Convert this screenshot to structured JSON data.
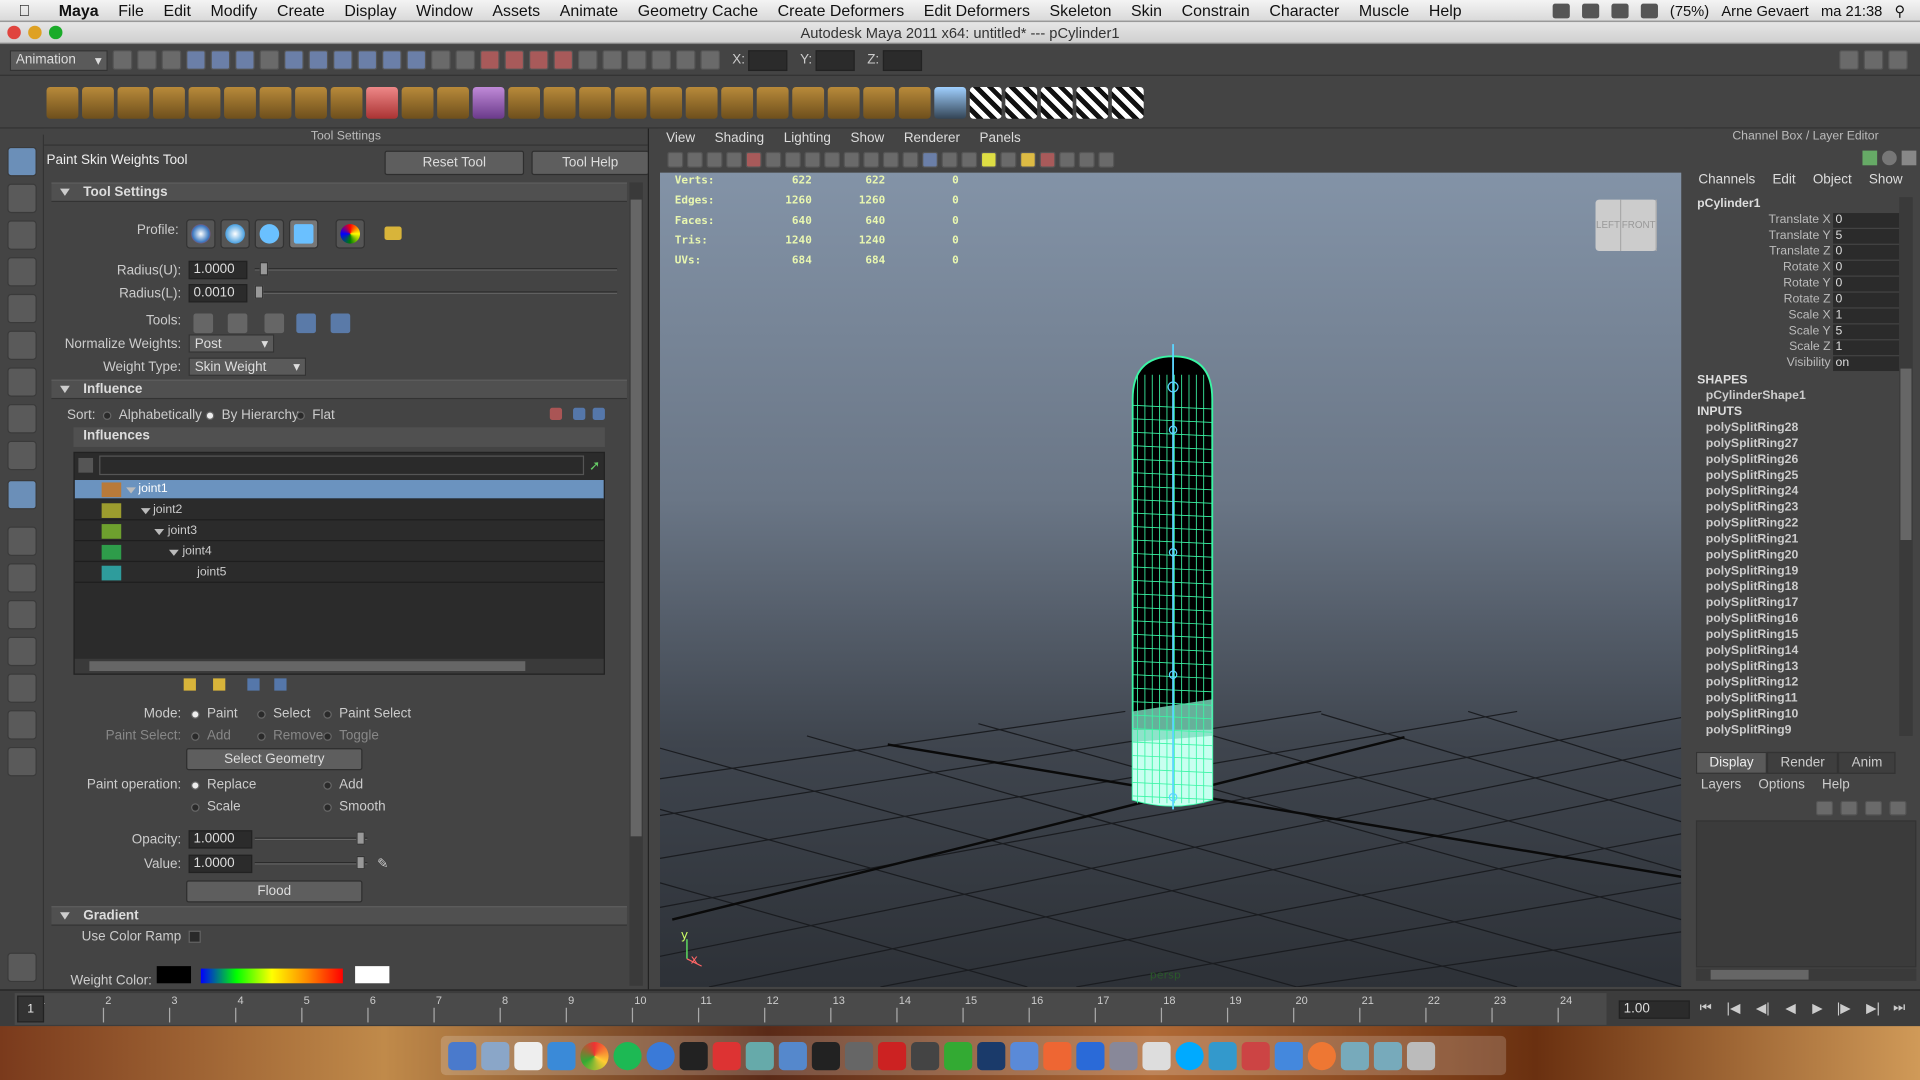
{
  "macmenu": {
    "app": "Maya",
    "items": [
      "File",
      "Edit",
      "Modify",
      "Create",
      "Display",
      "Window",
      "Assets",
      "Animate",
      "Geometry Cache",
      "Create Deformers",
      "Edit Deformers",
      "Skeleton",
      "Skin",
      "Constrain",
      "Character",
      "Muscle",
      "Help"
    ],
    "battery": "(75%)",
    "user": "Arne Gevaert",
    "clock": "ma 21:38"
  },
  "window": {
    "title": "Autodesk Maya 2011 x64: untitled*   ---   pCylinder1"
  },
  "statusline": {
    "menuset": "Animation",
    "x_label": "X:",
    "y_label": "Y:",
    "z_label": "Z:"
  },
  "toolsettings": {
    "header": "Tool Settings",
    "tool_name": "Paint Skin Weights Tool",
    "reset": "Reset Tool",
    "help": "Tool Help",
    "section_tool": "Tool Settings",
    "profile_label": "Profile:",
    "radius_u_label": "Radius(U):",
    "radius_u": "1.0000",
    "radius_l_label": "Radius(L):",
    "radius_l": "0.0010",
    "tools_label": "Tools:",
    "normalize_label": "Normalize Weights:",
    "normalize_value": "Post",
    "weight_type_label": "Weight Type:",
    "weight_type_value": "Skin Weight",
    "section_influence": "Influence",
    "sort_label": "Sort:",
    "sort_alpha": "Alphabetically",
    "sort_hier": "By Hierarchy",
    "sort_flat": "Flat",
    "influences_header": "Influences",
    "joints": [
      "joint1",
      "joint2",
      "joint3",
      "joint4",
      "joint5"
    ],
    "joint_colors": [
      "#b87a3a",
      "#9c9c2e",
      "#6ea02e",
      "#2e9c4a",
      "#2e9c9c"
    ],
    "mode_label": "Mode:",
    "mode_paint": "Paint",
    "mode_select": "Select",
    "mode_paint_select": "Paint Select",
    "paint_select_label": "Paint Select:",
    "ps_add": "Add",
    "ps_remove": "Remove",
    "ps_toggle": "Toggle",
    "select_geometry": "Select Geometry",
    "paint_op_label": "Paint operation:",
    "op_replace": "Replace",
    "op_add": "Add",
    "op_scale": "Scale",
    "op_smooth": "Smooth",
    "opacity_label": "Opacity:",
    "opacity": "1.0000",
    "value_label": "Value:",
    "value": "1.0000",
    "flood": "Flood",
    "section_gradient": "Gradient",
    "use_color_ramp": "Use Color Ramp",
    "weight_color_label": "Weight Color:"
  },
  "viewport": {
    "menu": [
      "View",
      "Shading",
      "Lighting",
      "Show",
      "Renderer",
      "Panels"
    ],
    "hud": [
      {
        "label": "Verts:",
        "a": "622",
        "b": "622",
        "c": "0"
      },
      {
        "label": "Edges:",
        "a": "1260",
        "b": "1260",
        "c": "0"
      },
      {
        "label": "Faces:",
        "a": "640",
        "b": "640",
        "c": "0"
      },
      {
        "label": "Tris:",
        "a": "1240",
        "b": "1240",
        "c": "0"
      },
      {
        "label": "UVs:",
        "a": "684",
        "b": "684",
        "c": "0"
      }
    ],
    "cube_left": "LEFT",
    "cube_front": "FRONT",
    "camera": "persp",
    "axis_y": "y",
    "axis_x": "x"
  },
  "channelbox": {
    "header": "Channel Box / Layer Editor",
    "menu": [
      "Channels",
      "Edit",
      "Object",
      "Show"
    ],
    "object": "pCylinder1",
    "attrs": [
      {
        "n": "Translate X",
        "v": "0"
      },
      {
        "n": "Translate Y",
        "v": "5"
      },
      {
        "n": "Translate Z",
        "v": "0"
      },
      {
        "n": "Rotate X",
        "v": "0"
      },
      {
        "n": "Rotate Y",
        "v": "0"
      },
      {
        "n": "Rotate Z",
        "v": "0"
      },
      {
        "n": "Scale X",
        "v": "1"
      },
      {
        "n": "Scale Y",
        "v": "5"
      },
      {
        "n": "Scale Z",
        "v": "1"
      },
      {
        "n": "Visibility",
        "v": "on"
      }
    ],
    "shapes_label": "SHAPES",
    "shape": "pCylinderShape1",
    "inputs_label": "INPUTS",
    "inputs": [
      "polySplitRing28",
      "polySplitRing27",
      "polySplitRing26",
      "polySplitRing25",
      "polySplitRing24",
      "polySplitRing23",
      "polySplitRing22",
      "polySplitRing21",
      "polySplitRing20",
      "polySplitRing19",
      "polySplitRing18",
      "polySplitRing17",
      "polySplitRing16",
      "polySplitRing15",
      "polySplitRing14",
      "polySplitRing13",
      "polySplitRing12",
      "polySplitRing11",
      "polySplitRing10",
      "polySplitRing9"
    ],
    "tabs": [
      "Display",
      "Render",
      "Anim"
    ],
    "layer_menu": [
      "Layers",
      "Options",
      "Help"
    ]
  },
  "timeline": {
    "frames": [
      "1",
      "2",
      "3",
      "4",
      "5",
      "6",
      "7",
      "8",
      "9",
      "10",
      "11",
      "12",
      "13",
      "14",
      "15",
      "16",
      "17",
      "18",
      "19",
      "20",
      "21",
      "22",
      "23",
      "24"
    ],
    "current": "1",
    "playback_speed": "1.00"
  }
}
